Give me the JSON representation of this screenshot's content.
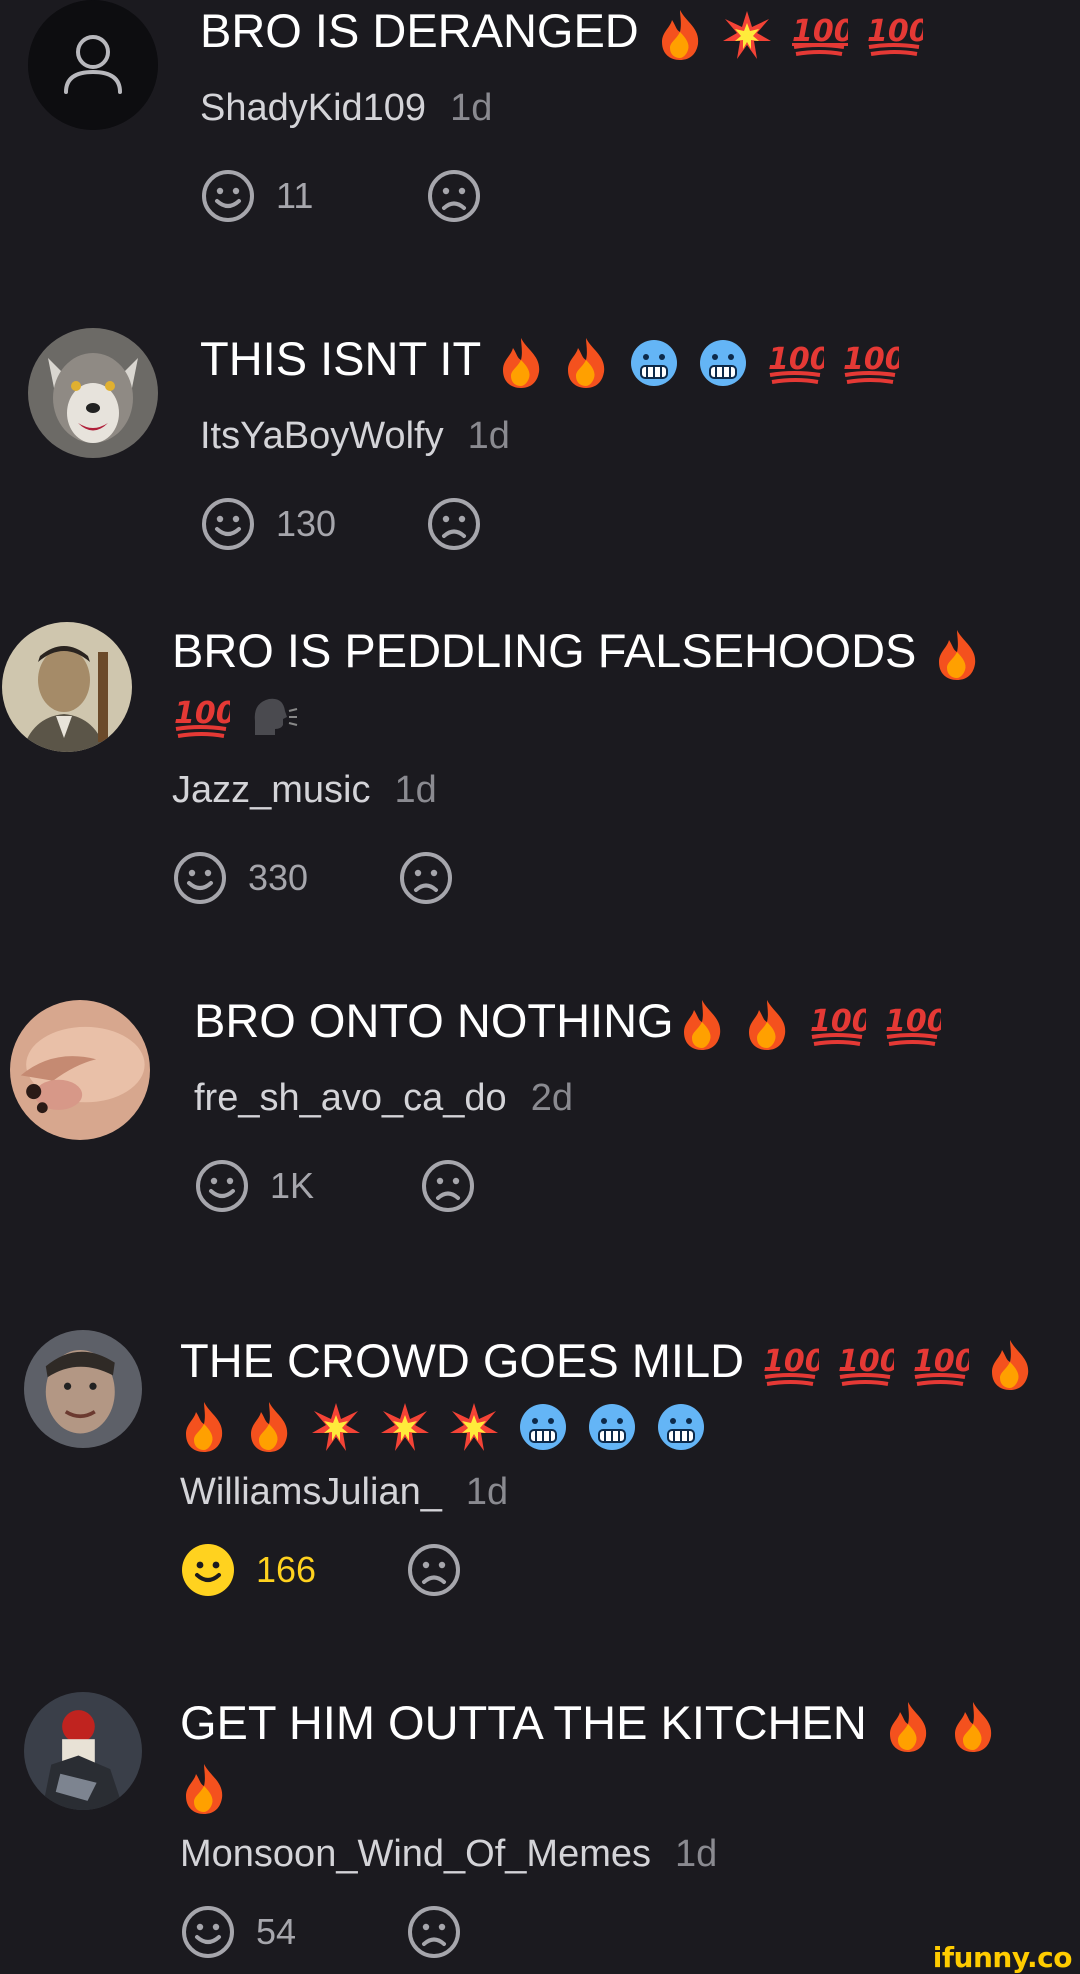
{
  "comments": [
    {
      "avatar": "default-user-icon",
      "text_lines": [
        "BRO IS DERANGED"
      ],
      "emojis": [
        "fire",
        "collision",
        "hundred",
        "hundred"
      ],
      "author": "ShadyKid109",
      "time": "1d",
      "likes": "11",
      "liked": false
    },
    {
      "avatar": "wolf-avatar",
      "text_lines": [
        "THIS ISNT IT"
      ],
      "emojis": [
        "fire",
        "fire",
        "cold-face",
        "cold-face",
        "hundred",
        "hundred"
      ],
      "author": "ItsYaBoyWolfy",
      "time": "1d",
      "likes": "130",
      "liked": false
    },
    {
      "avatar": "portrait-avatar",
      "text_lines": [
        "BRO IS PEDDLING FALSEHOODS"
      ],
      "emojis": [
        "fire",
        "hundred",
        "speaking-head"
      ],
      "author": "Jazz_music",
      "time": "1d",
      "likes": "330",
      "liked": false
    },
    {
      "avatar": "closeup-avatar",
      "text_lines": [
        "BRO ONTO NOTHING"
      ],
      "emojis": [
        "fire",
        "fire",
        "hundred",
        "hundred"
      ],
      "author": "fre_sh_avo_ca_do",
      "time": "2d",
      "likes": "1K",
      "liked": false
    },
    {
      "avatar": "face-avatar",
      "text_lines": [
        "THE CROWD GOES MILD"
      ],
      "emojis": [
        "hundred",
        "hundred",
        "hundred",
        "fire",
        "fire",
        "fire",
        "collision",
        "collision",
        "collision",
        "cold-face",
        "cold-face",
        "cold-face"
      ],
      "author": "WilliamsJulian_",
      "time": "1d",
      "likes": "166",
      "liked": true
    },
    {
      "avatar": "helmet-avatar",
      "text_lines": [
        "GET HIM OUTTA THE KITCHEN"
      ],
      "emojis": [
        "fire",
        "fire",
        "fire"
      ],
      "author": "Monsoon_Wind_Of_Memes",
      "time": "1d",
      "likes": "54",
      "liked": false
    }
  ],
  "watermark": "ifunny.co",
  "colors": {
    "background": "#1b1a1f",
    "text": "#ffffff",
    "author": "#d4d4d8",
    "time": "#8a8a90",
    "liked": "#ffd21f"
  }
}
